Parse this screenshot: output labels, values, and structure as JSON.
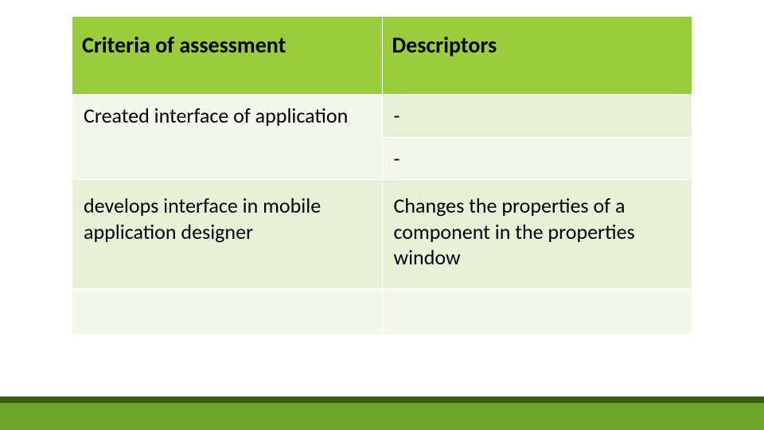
{
  "table": {
    "headers": {
      "criteria": "Criteria of assessment",
      "descriptors": "Descriptors"
    },
    "row1": {
      "criteria": "Created interface of application",
      "desc_a": " -",
      "desc_b": " -"
    },
    "row2": {
      "criteria": "develops interface in mobile application designer",
      "descriptor": "Changes the properties of a component in the properties window"
    },
    "row3": {
      "criteria": "",
      "descriptor": ""
    }
  }
}
